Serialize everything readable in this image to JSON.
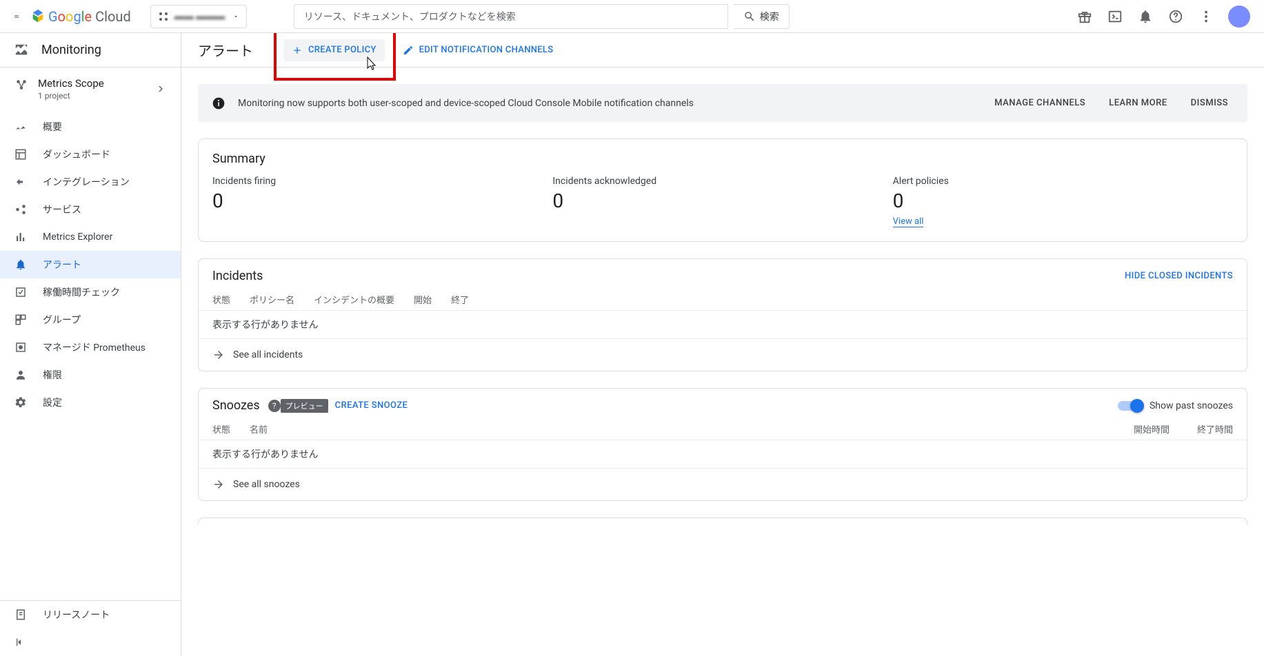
{
  "header": {
    "logo_text": "Google Cloud",
    "search_placeholder": "リソース、ドキュメント、プロダクトなどを検索",
    "search_btn": "検索"
  },
  "sidebar": {
    "product": "Monitoring",
    "scope_title": "Metrics Scope",
    "scope_sub": "1 project",
    "items": [
      {
        "label": "概要"
      },
      {
        "label": "ダッシュボード"
      },
      {
        "label": "インテグレーション"
      },
      {
        "label": "サービス"
      },
      {
        "label": "Metrics Explorer"
      },
      {
        "label": "アラート"
      },
      {
        "label": "稼働時間チェック"
      },
      {
        "label": "グループ"
      },
      {
        "label": "マネージド Prometheus"
      },
      {
        "label": "権限"
      },
      {
        "label": "設定"
      }
    ],
    "release_notes": "リリースノート"
  },
  "page": {
    "title": "アラート",
    "create_policy": "CREATE POLICY",
    "edit_channels": "EDIT NOTIFICATION CHANNELS"
  },
  "banner": {
    "text": "Monitoring now supports both user-scoped and device-scoped Cloud Console Mobile notification channels",
    "manage": "MANAGE CHANNELS",
    "learn": "LEARN MORE",
    "dismiss": "DISMISS"
  },
  "summary": {
    "title": "Summary",
    "firing_label": "Incidents firing",
    "firing_val": "0",
    "ack_label": "Incidents acknowledged",
    "ack_val": "0",
    "policies_label": "Alert policies",
    "policies_val": "0",
    "view_all": "View all"
  },
  "incidents": {
    "title": "Incidents",
    "hide_closed": "HIDE CLOSED INCIDENTS",
    "cols": {
      "state": "状態",
      "policy": "ポリシー名",
      "summary": "インシデントの概要",
      "start": "開始",
      "end": "終了"
    },
    "no_rows": "表示する行がありません",
    "see_all": "See all incidents"
  },
  "snoozes": {
    "title": "Snoozes",
    "preview_badge": "プレビュー",
    "create": "CREATE SNOOZE",
    "show_past": "Show past snoozes",
    "cols": {
      "state": "状態",
      "name": "名前",
      "start": "開始時間",
      "end": "終了時間"
    },
    "no_rows": "表示する行がありません",
    "see_all": "See all snoozes"
  }
}
